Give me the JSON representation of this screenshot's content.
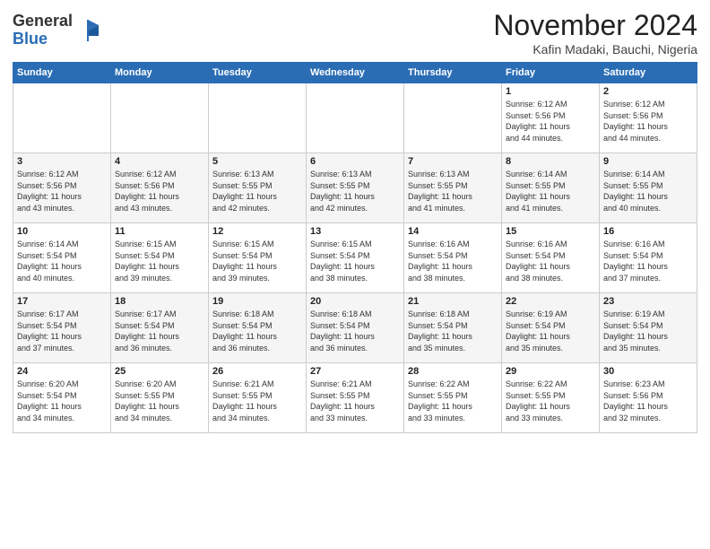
{
  "header": {
    "logo_general": "General",
    "logo_blue": "Blue",
    "month_title": "November 2024",
    "location": "Kafin Madaki, Bauchi, Nigeria"
  },
  "days_of_week": [
    "Sunday",
    "Monday",
    "Tuesday",
    "Wednesday",
    "Thursday",
    "Friday",
    "Saturday"
  ],
  "weeks": [
    [
      {
        "day": "",
        "info": ""
      },
      {
        "day": "",
        "info": ""
      },
      {
        "day": "",
        "info": ""
      },
      {
        "day": "",
        "info": ""
      },
      {
        "day": "",
        "info": ""
      },
      {
        "day": "1",
        "info": "Sunrise: 6:12 AM\nSunset: 5:56 PM\nDaylight: 11 hours\nand 44 minutes."
      },
      {
        "day": "2",
        "info": "Sunrise: 6:12 AM\nSunset: 5:56 PM\nDaylight: 11 hours\nand 44 minutes."
      }
    ],
    [
      {
        "day": "3",
        "info": "Sunrise: 6:12 AM\nSunset: 5:56 PM\nDaylight: 11 hours\nand 43 minutes."
      },
      {
        "day": "4",
        "info": "Sunrise: 6:12 AM\nSunset: 5:56 PM\nDaylight: 11 hours\nand 43 minutes."
      },
      {
        "day": "5",
        "info": "Sunrise: 6:13 AM\nSunset: 5:55 PM\nDaylight: 11 hours\nand 42 minutes."
      },
      {
        "day": "6",
        "info": "Sunrise: 6:13 AM\nSunset: 5:55 PM\nDaylight: 11 hours\nand 42 minutes."
      },
      {
        "day": "7",
        "info": "Sunrise: 6:13 AM\nSunset: 5:55 PM\nDaylight: 11 hours\nand 41 minutes."
      },
      {
        "day": "8",
        "info": "Sunrise: 6:14 AM\nSunset: 5:55 PM\nDaylight: 11 hours\nand 41 minutes."
      },
      {
        "day": "9",
        "info": "Sunrise: 6:14 AM\nSunset: 5:55 PM\nDaylight: 11 hours\nand 40 minutes."
      }
    ],
    [
      {
        "day": "10",
        "info": "Sunrise: 6:14 AM\nSunset: 5:54 PM\nDaylight: 11 hours\nand 40 minutes."
      },
      {
        "day": "11",
        "info": "Sunrise: 6:15 AM\nSunset: 5:54 PM\nDaylight: 11 hours\nand 39 minutes."
      },
      {
        "day": "12",
        "info": "Sunrise: 6:15 AM\nSunset: 5:54 PM\nDaylight: 11 hours\nand 39 minutes."
      },
      {
        "day": "13",
        "info": "Sunrise: 6:15 AM\nSunset: 5:54 PM\nDaylight: 11 hours\nand 38 minutes."
      },
      {
        "day": "14",
        "info": "Sunrise: 6:16 AM\nSunset: 5:54 PM\nDaylight: 11 hours\nand 38 minutes."
      },
      {
        "day": "15",
        "info": "Sunrise: 6:16 AM\nSunset: 5:54 PM\nDaylight: 11 hours\nand 38 minutes."
      },
      {
        "day": "16",
        "info": "Sunrise: 6:16 AM\nSunset: 5:54 PM\nDaylight: 11 hours\nand 37 minutes."
      }
    ],
    [
      {
        "day": "17",
        "info": "Sunrise: 6:17 AM\nSunset: 5:54 PM\nDaylight: 11 hours\nand 37 minutes."
      },
      {
        "day": "18",
        "info": "Sunrise: 6:17 AM\nSunset: 5:54 PM\nDaylight: 11 hours\nand 36 minutes."
      },
      {
        "day": "19",
        "info": "Sunrise: 6:18 AM\nSunset: 5:54 PM\nDaylight: 11 hours\nand 36 minutes."
      },
      {
        "day": "20",
        "info": "Sunrise: 6:18 AM\nSunset: 5:54 PM\nDaylight: 11 hours\nand 36 minutes."
      },
      {
        "day": "21",
        "info": "Sunrise: 6:18 AM\nSunset: 5:54 PM\nDaylight: 11 hours\nand 35 minutes."
      },
      {
        "day": "22",
        "info": "Sunrise: 6:19 AM\nSunset: 5:54 PM\nDaylight: 11 hours\nand 35 minutes."
      },
      {
        "day": "23",
        "info": "Sunrise: 6:19 AM\nSunset: 5:54 PM\nDaylight: 11 hours\nand 35 minutes."
      }
    ],
    [
      {
        "day": "24",
        "info": "Sunrise: 6:20 AM\nSunset: 5:54 PM\nDaylight: 11 hours\nand 34 minutes."
      },
      {
        "day": "25",
        "info": "Sunrise: 6:20 AM\nSunset: 5:55 PM\nDaylight: 11 hours\nand 34 minutes."
      },
      {
        "day": "26",
        "info": "Sunrise: 6:21 AM\nSunset: 5:55 PM\nDaylight: 11 hours\nand 34 minutes."
      },
      {
        "day": "27",
        "info": "Sunrise: 6:21 AM\nSunset: 5:55 PM\nDaylight: 11 hours\nand 33 minutes."
      },
      {
        "day": "28",
        "info": "Sunrise: 6:22 AM\nSunset: 5:55 PM\nDaylight: 11 hours\nand 33 minutes."
      },
      {
        "day": "29",
        "info": "Sunrise: 6:22 AM\nSunset: 5:55 PM\nDaylight: 11 hours\nand 33 minutes."
      },
      {
        "day": "30",
        "info": "Sunrise: 6:23 AM\nSunset: 5:56 PM\nDaylight: 11 hours\nand 32 minutes."
      }
    ]
  ]
}
